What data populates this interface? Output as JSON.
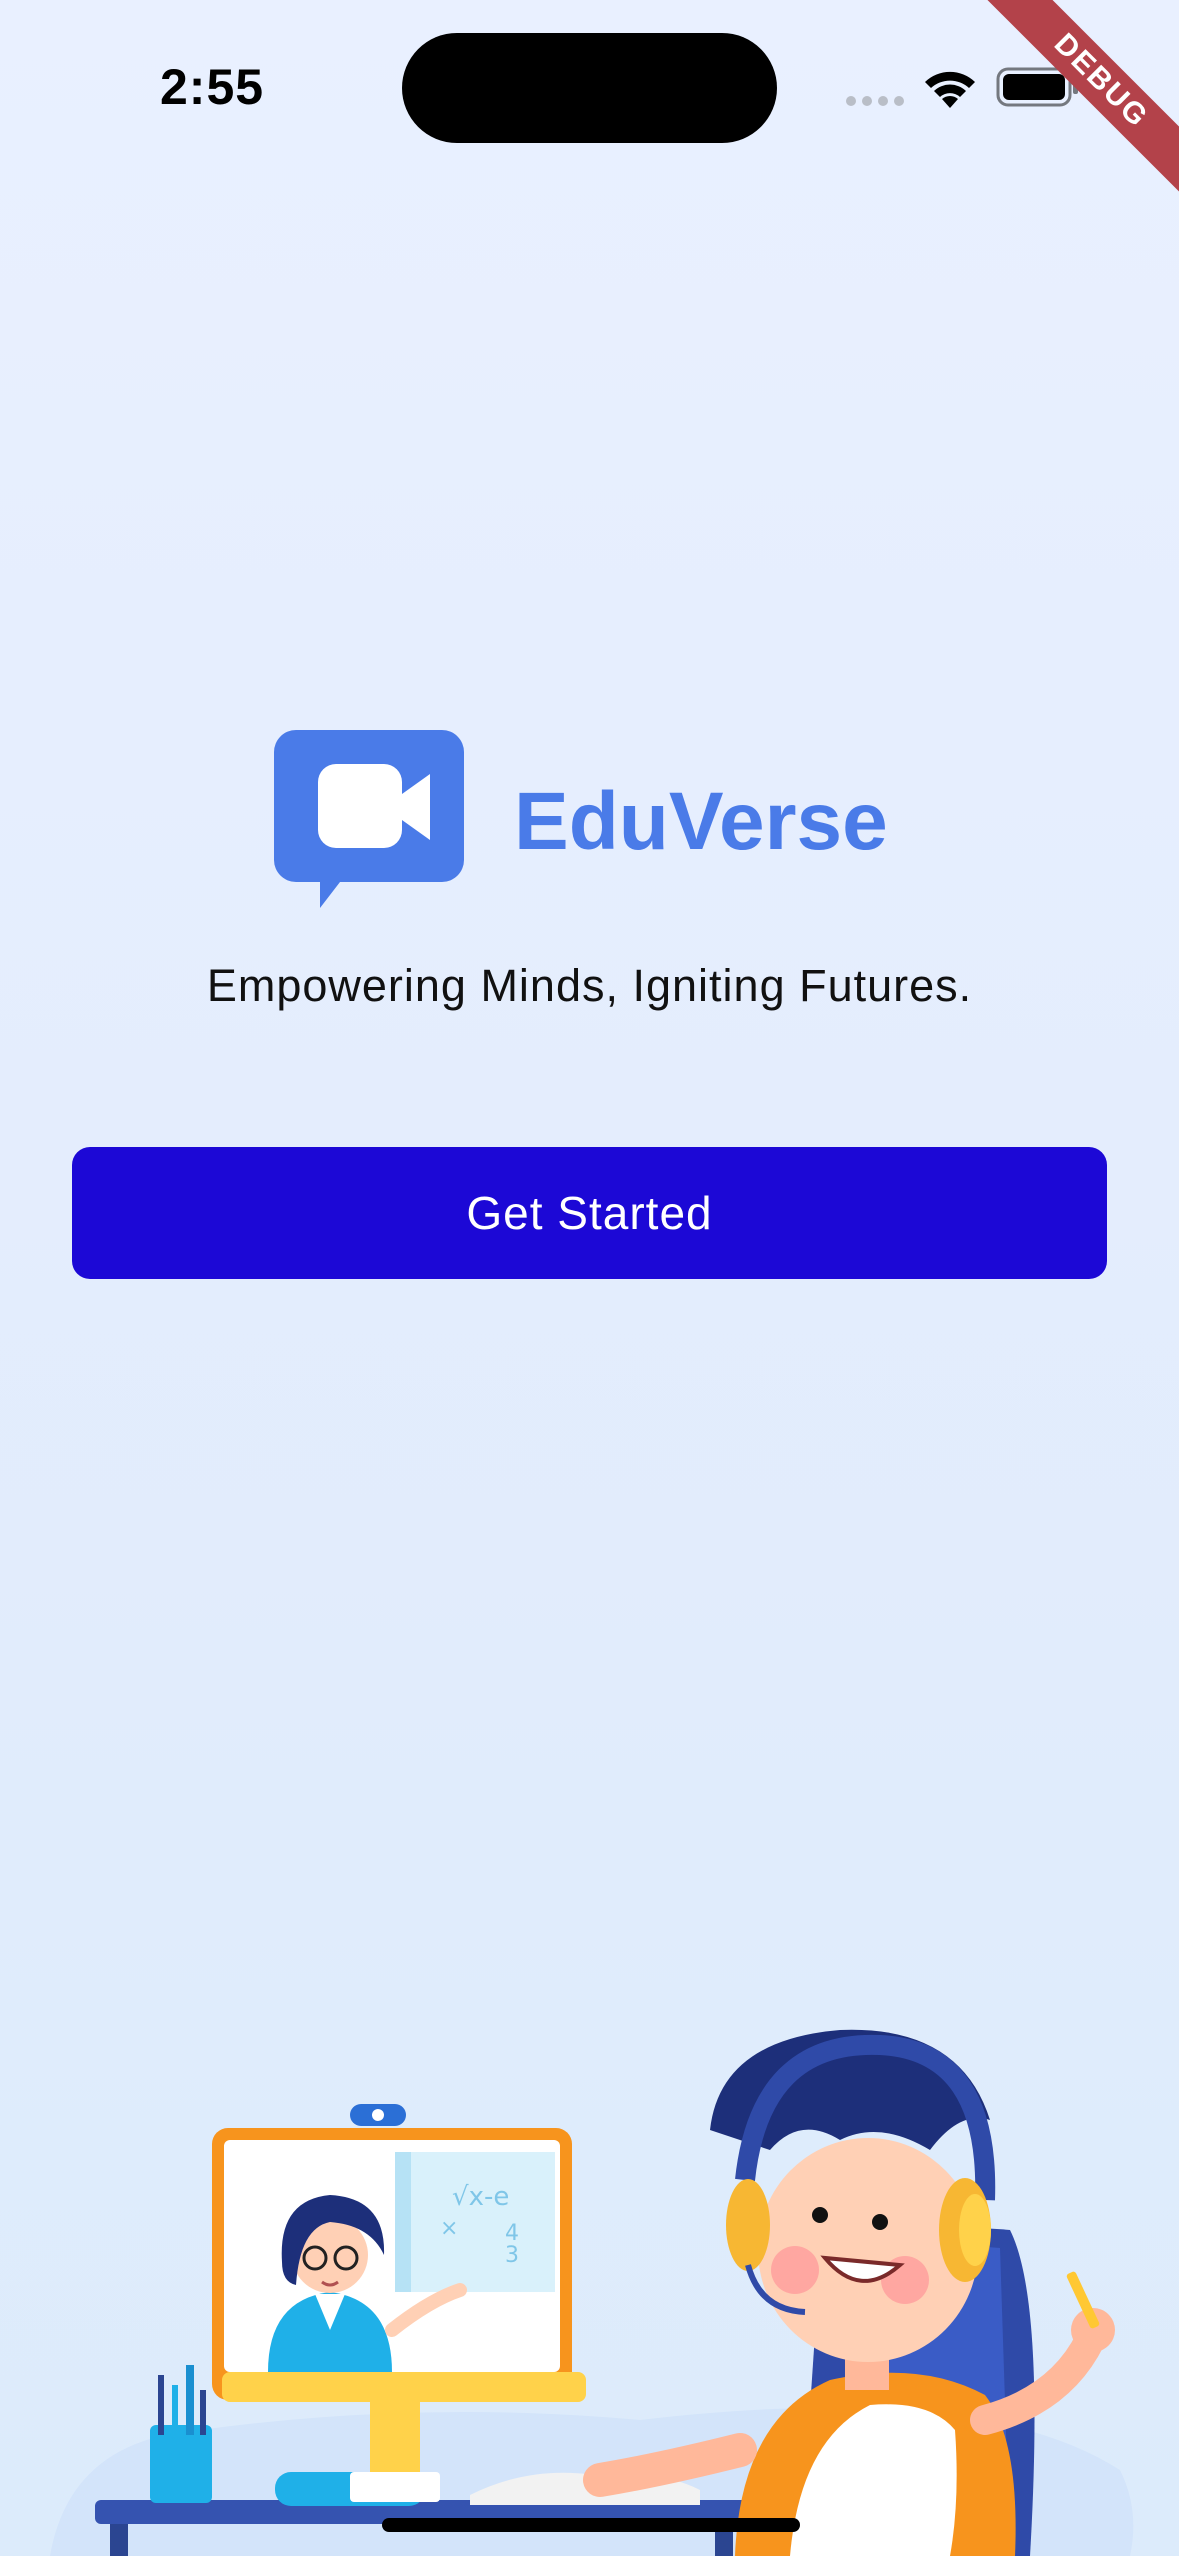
{
  "status_bar": {
    "time": "2:55",
    "debug_label": "DEBUG"
  },
  "brand": {
    "name": "EduVerse",
    "tagline": "Empowering Minds, Igniting Futures.",
    "logo_icon": "video-chat-icon",
    "brand_color": "#4a7be8"
  },
  "cta": {
    "label": "Get Started",
    "color": "#1c08d6"
  },
  "illustration": {
    "subject": "student-online-class-illustration"
  }
}
